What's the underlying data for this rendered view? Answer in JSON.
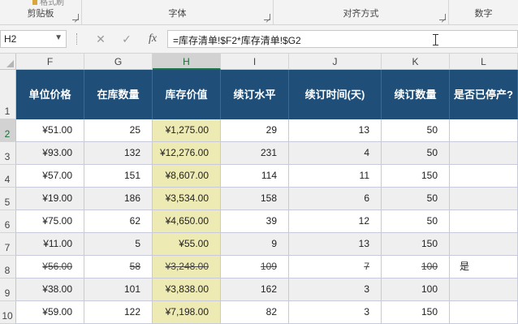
{
  "ribbon": {
    "groups": [
      {
        "label": "剪贴板"
      },
      {
        "label": "字体"
      },
      {
        "label": "对齐方式"
      },
      {
        "label": "数字"
      }
    ],
    "painter_label": "格式刷"
  },
  "formula_bar": {
    "name_box": "H2",
    "cancel_glyph": "✕",
    "enter_glyph": "✓",
    "fx_glyph": "fx",
    "formula": "=库存清单!$F2*库存清单!$G2"
  },
  "columns": [
    "F",
    "G",
    "H",
    "I",
    "J",
    "K",
    "L"
  ],
  "row_numbers": [
    "1",
    "2",
    "3",
    "4",
    "5",
    "6",
    "7",
    "8",
    "9",
    "10"
  ],
  "headers": [
    "单位价格",
    "在库数量",
    "库存价值",
    "续订水平",
    "续订时间(天)",
    "续订数量",
    "是否已停产?"
  ],
  "rows": [
    [
      "¥51.00",
      "25",
      "¥1,275.00",
      "29",
      "13",
      "50",
      ""
    ],
    [
      "¥93.00",
      "132",
      "¥12,276.00",
      "231",
      "4",
      "50",
      ""
    ],
    [
      "¥57.00",
      "151",
      "¥8,607.00",
      "114",
      "11",
      "150",
      ""
    ],
    [
      "¥19.00",
      "186",
      "¥3,534.00",
      "158",
      "6",
      "50",
      ""
    ],
    [
      "¥75.00",
      "62",
      "¥4,650.00",
      "39",
      "12",
      "50",
      ""
    ],
    [
      "¥11.00",
      "5",
      "¥55.00",
      "9",
      "13",
      "150",
      ""
    ],
    [
      "¥56.00",
      "58",
      "¥3,248.00",
      "109",
      "7",
      "100",
      "是"
    ],
    [
      "¥38.00",
      "101",
      "¥3,838.00",
      "162",
      "3",
      "100",
      ""
    ],
    [
      "¥59.00",
      "122",
      "¥7,198.00",
      "82",
      "3",
      "150",
      ""
    ]
  ],
  "struck_row_index": 6,
  "colors": {
    "header_bg": "#1f4e79",
    "highlight": "#eeeab3",
    "excel_green": "#217346"
  }
}
